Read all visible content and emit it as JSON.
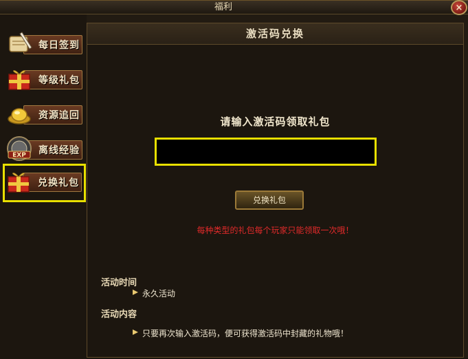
{
  "window": {
    "title": "福利",
    "close_label": "×"
  },
  "sidebar": {
    "items": [
      {
        "label": "每日签到",
        "icon": "scroll-quill-icon"
      },
      {
        "label": "等级礼包",
        "icon": "gift-box-icon"
      },
      {
        "label": "资源追回",
        "icon": "gold-ingot-icon"
      },
      {
        "label": "离线经验",
        "icon": "exp-book-icon"
      },
      {
        "label": "兑换礼包",
        "icon": "gift-box-icon",
        "selected": true
      }
    ]
  },
  "panel": {
    "title": "激活码兑换",
    "prompt": "请输入激活码领取礼包",
    "input": {
      "value": "",
      "placeholder": ""
    },
    "redeem_button": "兑换礼包",
    "warning": "每种类型的礼包每个玩家只能领取一次哦！",
    "activity_time": {
      "title": "活动时间",
      "text": "永久活动"
    },
    "activity_content": {
      "title": "活动内容",
      "text": "只要再次输入激活码，便可获得激活码中封藏的礼物哦！"
    }
  },
  "colors": {
    "highlight": "#e8e000",
    "warning": "#e02a2a",
    "accent_gold": "#a07840"
  }
}
